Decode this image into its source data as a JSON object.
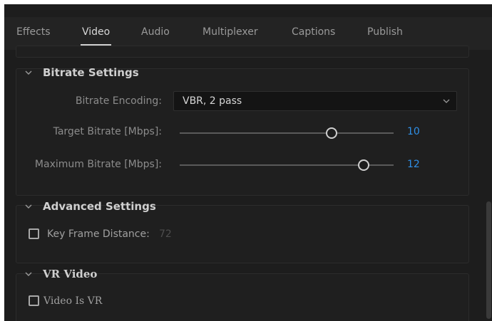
{
  "tabs": [
    {
      "label": "Effects"
    },
    {
      "label": "Video"
    },
    {
      "label": "Audio"
    },
    {
      "label": "Multiplexer"
    },
    {
      "label": "Captions"
    },
    {
      "label": "Publish"
    }
  ],
  "active_tab": "Video",
  "bitrate": {
    "title": "Bitrate Settings",
    "encoding_label": "Bitrate Encoding:",
    "encoding_value": "VBR, 2 pass",
    "target_label": "Target Bitrate [Mbps]:",
    "target_value": "10",
    "target_level": 0.71,
    "max_label": "Maximum Bitrate [Mbps]:",
    "max_value": "12",
    "max_level": 0.86
  },
  "advanced": {
    "title": "Advanced Settings",
    "keyframe_label": "Key Frame Distance:",
    "keyframe_value": "72",
    "keyframe_checked": false
  },
  "vr": {
    "title": "VR Video",
    "vr_label": "Video Is VR",
    "vr_checked": false
  },
  "colors": {
    "accent": "#2f8fe6",
    "background": "#1d1d1d"
  },
  "icons": [
    "chevron-down-icon",
    "checkbox-icon"
  ]
}
